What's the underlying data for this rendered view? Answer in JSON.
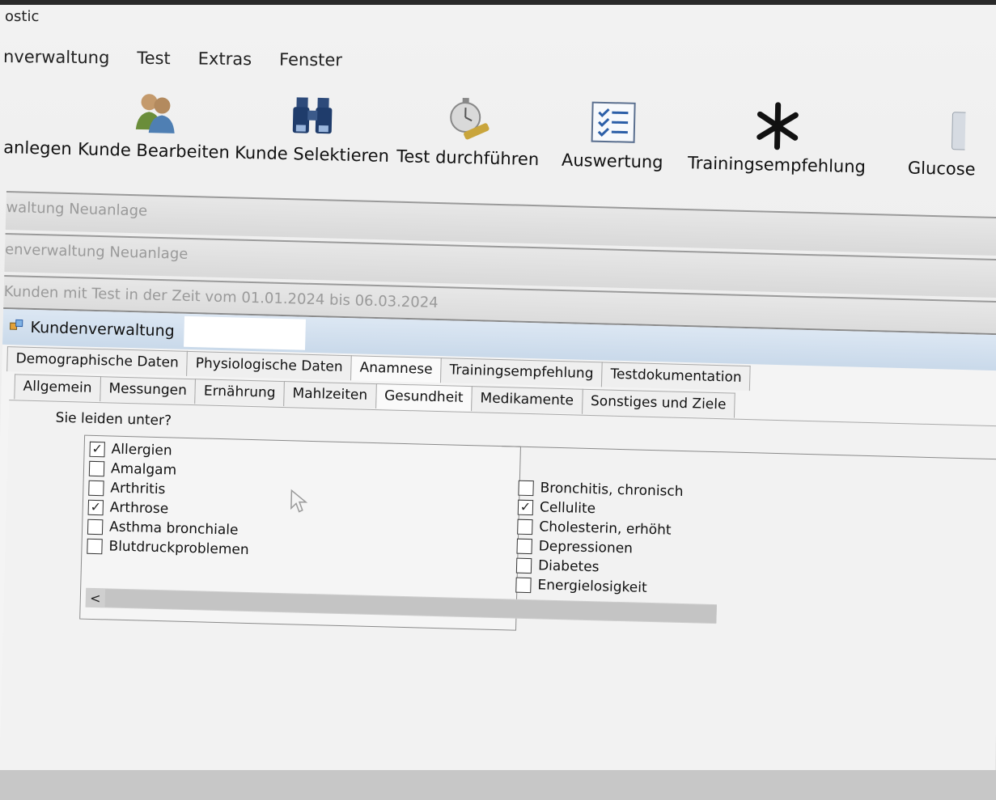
{
  "app": {
    "title": "ostic"
  },
  "menu": [
    "nverwaltung",
    "Test",
    "Extras",
    "Fenster"
  ],
  "toolbar": [
    {
      "label": "anlegen",
      "icon": "none"
    },
    {
      "label": "Kunde Bearbeiten",
      "icon": "users-icon"
    },
    {
      "label": "Kunde Selektieren",
      "icon": "binoculars-icon"
    },
    {
      "label": "Test durchführen",
      "icon": "stopwatch-icon"
    },
    {
      "label": "Auswertung",
      "icon": "checklist-icon"
    },
    {
      "label": "Trainingsempfehlung",
      "icon": "asterisk-icon"
    },
    {
      "label": "Glucose",
      "icon": "calculator-icon"
    }
  ],
  "mdi_windows": [
    {
      "title": "waltung Neuanlage"
    },
    {
      "title": "enverwaltung Neuanlage"
    },
    {
      "title": "Kunden mit Test in der Zeit vom 01.01.2024 bis 06.03.2024"
    }
  ],
  "child_window": {
    "title": "Kundenverwaltung",
    "tabs_main": [
      "Demographische Daten",
      "Physiologische Daten",
      "Anamnese",
      "Trainingsempfehlung",
      "Testdokumentation"
    ],
    "active_main_tab": "Anamnese",
    "tabs_sub": [
      "Allgemein",
      "Messungen",
      "Ernährung",
      "Mahlzeiten",
      "Gesundheit",
      "Medikamente",
      "Sonstiges und Ziele"
    ],
    "active_sub_tab": "Gesundheit",
    "question": "Sie leiden unter?",
    "list_left": [
      {
        "label": "Allergien",
        "checked": true
      },
      {
        "label": "Amalgam",
        "checked": false
      },
      {
        "label": "Arthritis",
        "checked": false
      },
      {
        "label": "Arthrose",
        "checked": true
      },
      {
        "label": "Asthma bronchiale",
        "checked": false
      },
      {
        "label": "Blutdruckproblemen",
        "checked": false
      }
    ],
    "list_right": [
      {
        "label": "Bronchitis, chronisch",
        "checked": false
      },
      {
        "label": "Cellulite",
        "checked": true
      },
      {
        "label": "Cholesterin, erhöht",
        "checked": false
      },
      {
        "label": "Depressionen",
        "checked": false
      },
      {
        "label": "Diabetes",
        "checked": false
      },
      {
        "label": "Energielosigkeit",
        "checked": false
      }
    ],
    "scroll_left_glyph": "<",
    "check_glyph": "✓"
  }
}
